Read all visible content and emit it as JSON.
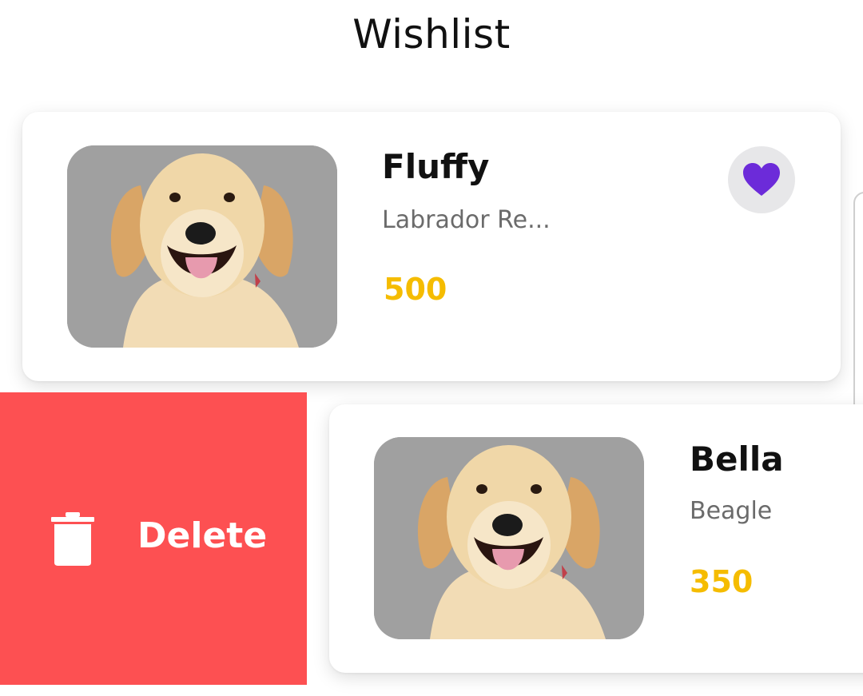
{
  "header": {
    "title": "Wishlist"
  },
  "wishlist": [
    {
      "name": "Fluffy",
      "breed": "Labrador Re...",
      "price": "500",
      "favorited": true,
      "favorite_icon": "heart-icon"
    },
    {
      "name": "Bella",
      "breed": "Beagle",
      "price": "350"
    }
  ],
  "swipe_action": {
    "label": "Delete",
    "icon": "trash-icon",
    "color": "#fd5052"
  },
  "colors": {
    "price": "#f5bc00",
    "heart": "#6c2bd9",
    "delete_bg": "#fd5052"
  }
}
